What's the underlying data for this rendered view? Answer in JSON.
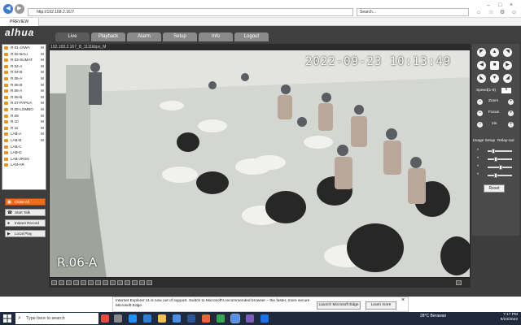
{
  "browser": {
    "url": "http://192.168.2.167/",
    "search_placeholder": "Search...",
    "tab_title": "PREVIEW"
  },
  "app": {
    "logo": "alhua",
    "nav": [
      "Live",
      "Playback",
      "Alarm",
      "Setup",
      "Info",
      "Logout"
    ],
    "active_nav": "Live"
  },
  "sidebar": {
    "cameras": [
      {
        "label": "R.01-JAWA",
        "flag": "M"
      },
      {
        "label": "R.02-BALI",
        "flag": "M"
      },
      {
        "label": "R.03-SUMAT",
        "flag": "M"
      },
      {
        "label": "R.04-A",
        "flag": "M"
      },
      {
        "label": "R.04-B",
        "flag": "M"
      },
      {
        "label": "R.05-A",
        "flag": "M"
      },
      {
        "label": "R.05-B",
        "flag": "M"
      },
      {
        "label": "R.06-A",
        "flag": "M"
      },
      {
        "label": "R.06-B",
        "flag": "M"
      },
      {
        "label": "R.07-PAPUA",
        "flag": "M"
      },
      {
        "label": "R.08-LOMBO",
        "flag": "M"
      },
      {
        "label": "R.09",
        "flag": "M"
      },
      {
        "label": "R.10",
        "flag": "M"
      },
      {
        "label": "R.11",
        "flag": "M"
      },
      {
        "label": "LAB-A",
        "flag": "M"
      },
      {
        "label": "LAB-B",
        "flag": "M"
      },
      {
        "label": "LAB-C",
        "flag": ""
      },
      {
        "label": "LAB-D",
        "flag": ""
      },
      {
        "label": "LAB-JRGN",
        "flag": ""
      },
      {
        "label": "LAN-AR",
        "flag": ""
      }
    ],
    "buttons": {
      "close_all": "Close All",
      "start_talk": "Start Talk",
      "instant_record": "Instant Record",
      "local_play": "Local Play"
    }
  },
  "video": {
    "info": "192.168.2.167_B_1111kbps_M",
    "timestamp": "2022-09-23 10:13:49",
    "camera_label": "R.06-A"
  },
  "ptz": {
    "speed_label": "Speed(1-8)",
    "speed_value": "5",
    "zoom": "Zoom",
    "focus": "Focus",
    "iris": "Iris",
    "image_setup": "Image Setup",
    "relay_out": "Relay-out",
    "reset": "Reset",
    "sliders": [
      0.2,
      0.3,
      0.55,
      0.3
    ]
  },
  "notification": {
    "message": "Internet Explorer 11 is now out of support. Switch to Microsoft's recommended browser – the faster, more secure Microsoft Edge.",
    "launch": "Launch Microsoft Edge",
    "learn": "Learn more"
  },
  "taskbar": {
    "search": "Type here to search",
    "weather": "28°C  Berawan",
    "time": "7:17 PM",
    "date": "9/23/2022"
  }
}
